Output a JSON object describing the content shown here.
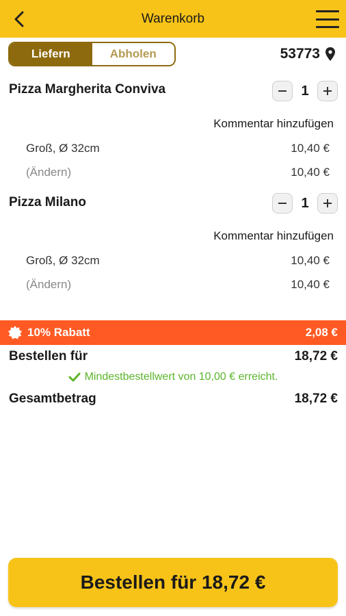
{
  "colors": {
    "header_bg": "#f7c318",
    "toggle_active": "#8d6a0e",
    "rabatt_bg": "#ff5a23",
    "success_green": "#5bb52a"
  },
  "header": {
    "title": "Warenkorb",
    "back_icon": "chevron-left-icon",
    "menu_icon": "hamburger-menu-icon"
  },
  "delivery": {
    "options": [
      "Liefern",
      "Abholen"
    ],
    "selected": "Liefern",
    "zip": "53773",
    "zip_icon": "location-pin-icon"
  },
  "items": [
    {
      "name": "Pizza Margherita Conviva",
      "quantity": "1",
      "comment_label": "Kommentar hinzufügen",
      "option": "Groß, Ø 32cm",
      "option_price": "10,40 €",
      "change_label": "(Ändern)",
      "total": "10,40 €"
    },
    {
      "name": "Pizza Milano",
      "quantity": "1",
      "comment_label": "Kommentar hinzufügen",
      "option": "Groß, Ø 32cm",
      "option_price": "10,40 €",
      "change_label": "(Ändern)",
      "total": "10,40 €"
    }
  ],
  "discount": {
    "label": "10% Rabatt",
    "amount": "2,08 €",
    "icon": "badge-icon"
  },
  "summary": {
    "order_for_label": "Bestellen für",
    "order_for_value": "18,72 €",
    "min_order_note": "Mindestbestellwert von 10,00 € erreicht.",
    "total_label": "Gesamtbetrag",
    "total_value": "18,72 €"
  },
  "order_button": {
    "label": "Bestellen für 18,72 €"
  }
}
